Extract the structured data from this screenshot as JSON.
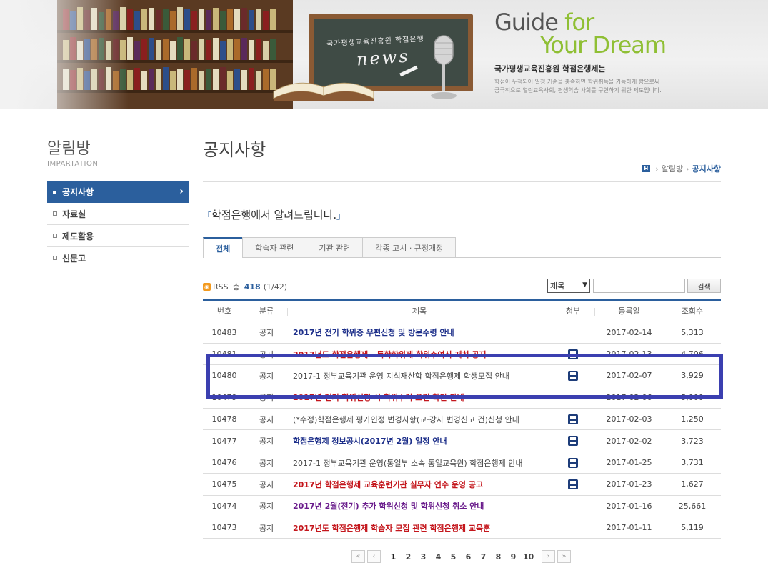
{
  "banner": {
    "board_title": "국가평생교육진흥원 학점은행",
    "board_text": "news",
    "guide": "Guide",
    "guide_for": " for",
    "dream": "Your Dream",
    "subtitle": "국가평생교육진흥원 학점은행제는",
    "desc_line1": "학점이 누적되어 일정 기준을 충족하면 학위취득을 가능하게 함으로써",
    "desc_line2": "궁극적으로 열린교육사회, 평생학습 사회를 구현하기 위한 제도입니다."
  },
  "sidebar": {
    "title": "알림방",
    "subtitle": "IMPARTATION",
    "items": [
      {
        "label": "공지사항",
        "active": true
      },
      {
        "label": "자료실",
        "active": false
      },
      {
        "label": "제도활용",
        "active": false
      },
      {
        "label": "신문고",
        "active": false
      }
    ]
  },
  "main": {
    "title": "공지사항",
    "breadcrumb": {
      "home": "H",
      "parent": "알림방",
      "current": "공지사항"
    },
    "notice_heading": "학점은행에서 알려드립니다.",
    "tabs": [
      {
        "label": "전체",
        "active": true
      },
      {
        "label": "학습자 관련",
        "active": false
      },
      {
        "label": "기관 관련",
        "active": false
      },
      {
        "label": "각종 고시 · 규정개정",
        "active": false
      }
    ],
    "rss_label": "RSS",
    "total_label": "총",
    "total": "418",
    "page_info": "(1/42)",
    "search_select": "제목",
    "search_button": "검색",
    "columns": [
      "번호",
      "분류",
      "제목",
      "첨부",
      "등록일",
      "조회수"
    ],
    "rows": [
      {
        "no": "10483",
        "cat": "공지",
        "title": "2017년 전기 학위증 우편신청 및 방문수령 안내",
        "style": "bold c-blue",
        "attach": false,
        "date": "2017-02-14",
        "views": "5,313"
      },
      {
        "no": "10481",
        "cat": "공지",
        "title": "2017년도 학점은행제 - 독학학위제 학위수여식 개최 공지",
        "style": "bold c-red",
        "attach": true,
        "date": "2017-02-13",
        "views": "4,706"
      },
      {
        "no": "10480",
        "cat": "공지",
        "title": "2017-1 정부교육기관 운영 지식재산학 학점은행제 학생모집 안내",
        "style": "c-gray",
        "attach": true,
        "date": "2017-02-07",
        "views": "3,929"
      },
      {
        "no": "10479",
        "cat": "공지",
        "title": "2017년 전기 학위신청 시 학위수여 요건 확인 안내",
        "style": "bold c-red",
        "attach": false,
        "date": "2017-02-06",
        "views": "5,000"
      },
      {
        "no": "10478",
        "cat": "공지",
        "title": "(*수정)학점은행제 평가인정 변경사항(교·강사 변경신고 건)신청 안내",
        "style": "c-gray",
        "attach": true,
        "date": "2017-02-03",
        "views": "1,250"
      },
      {
        "no": "10477",
        "cat": "공지",
        "title": "학점은행제 정보공시(2017년 2월) 일정 안내",
        "style": "bold c-blue",
        "attach": true,
        "date": "2017-02-02",
        "views": "3,723"
      },
      {
        "no": "10476",
        "cat": "공지",
        "title": "2017-1 정부교육기관 운영(통일부 소속 통일교육원) 학점은행제 안내",
        "style": "c-gray",
        "attach": true,
        "date": "2017-01-25",
        "views": "3,731"
      },
      {
        "no": "10475",
        "cat": "공지",
        "title": "2017년 학점은행제 교육훈련기관 실무자 연수 운영 공고",
        "style": "bold c-red",
        "attach": true,
        "date": "2017-01-23",
        "views": "1,627"
      },
      {
        "no": "10474",
        "cat": "공지",
        "title": "2017년 2월(전기) 추가 학위신청 및 학위신청 취소 안내",
        "style": "bold c-purple",
        "attach": false,
        "date": "2017-01-16",
        "views": "25,661"
      },
      {
        "no": "10473",
        "cat": "공지",
        "title": "2017년도 학점은행제 학습자 모집 관련 학점은행제 교육훈",
        "style": "bold c-red",
        "attach": false,
        "date": "2017-01-11",
        "views": "5,119"
      }
    ],
    "pager": {
      "first": "«",
      "prev": "‹",
      "pages": [
        "1",
        "2",
        "3",
        "4",
        "5",
        "6",
        "7",
        "8",
        "9",
        "10"
      ],
      "current": "1",
      "next": "›",
      "last": "»"
    }
  }
}
